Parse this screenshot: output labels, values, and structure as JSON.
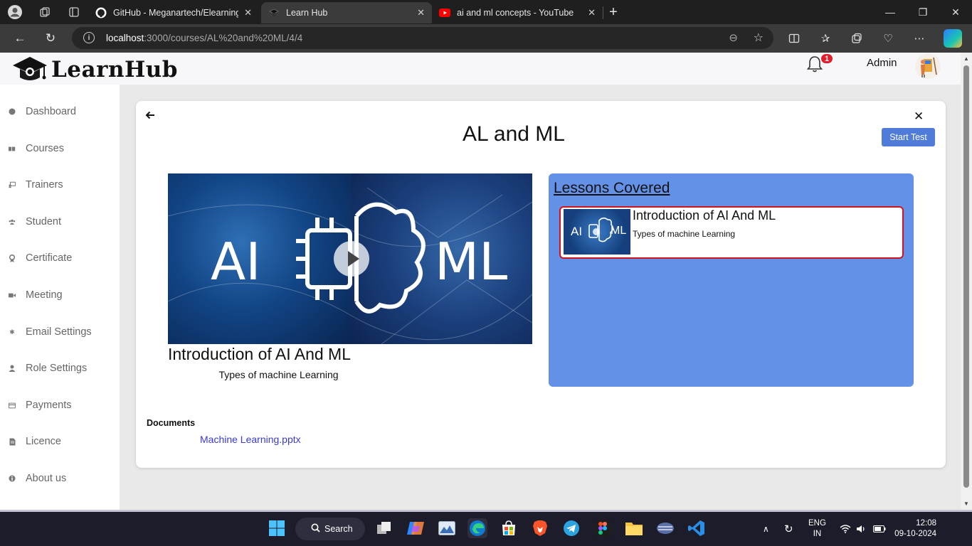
{
  "browser": {
    "tabs": [
      {
        "title": "GitHub - Meganartech/Elearning",
        "favicon": "github-icon",
        "active": false
      },
      {
        "title": "Learn Hub",
        "favicon": "learnhub-icon",
        "active": true
      },
      {
        "title": "ai and ml concepts - YouTube",
        "favicon": "youtube-icon",
        "active": false
      }
    ],
    "url": {
      "host": "localhost",
      "path": ":3000/courses/AL%20and%20ML/4/4"
    }
  },
  "app": {
    "brand": "LearnHub",
    "notification_count": "1",
    "user_name": "Admin",
    "colors": {
      "accent": "#4f7bd9",
      "panel": "#6391e8",
      "highlight_border": "#d0141b",
      "badge": "#e31b2a"
    }
  },
  "sidebar": {
    "items": [
      {
        "label": "Dashboard",
        "icon": "dashboard-icon"
      },
      {
        "label": "Courses",
        "icon": "courses-icon"
      },
      {
        "label": "Trainers",
        "icon": "trainers-icon"
      },
      {
        "label": "Student",
        "icon": "students-icon"
      },
      {
        "label": "Certificate",
        "icon": "certificate-icon"
      },
      {
        "label": "Meeting",
        "icon": "video-camera-icon"
      },
      {
        "label": "Email Settings",
        "icon": "gear-icon"
      },
      {
        "label": "Role Settings",
        "icon": "user-icon"
      },
      {
        "label": "Payments",
        "icon": "credit-card-icon"
      },
      {
        "label": "Licence",
        "icon": "document-icon"
      },
      {
        "label": "About us",
        "icon": "info-icon"
      }
    ]
  },
  "course": {
    "title": "AL and ML",
    "start_test_label": "Start Test",
    "video": {
      "left_text": "AI",
      "right_text": "ML"
    },
    "current_lesson": {
      "title": "Introduction of AI And ML",
      "subtitle": "Types of machine Learning"
    },
    "lessons_heading": "Lessons Covered",
    "lessons": [
      {
        "title": "Introduction of AI And ML",
        "subtitle": "Types of machine Learning",
        "thumb_left": "AI",
        "thumb_right": "ML"
      }
    ],
    "documents_label": "Documents",
    "documents": [
      {
        "name": "Machine Learning.pptx"
      }
    ]
  },
  "taskbar": {
    "search_label": "Search",
    "lang_top": "ENG",
    "lang_bottom": "IN",
    "time": "12:08",
    "date": "09-10-2024"
  }
}
